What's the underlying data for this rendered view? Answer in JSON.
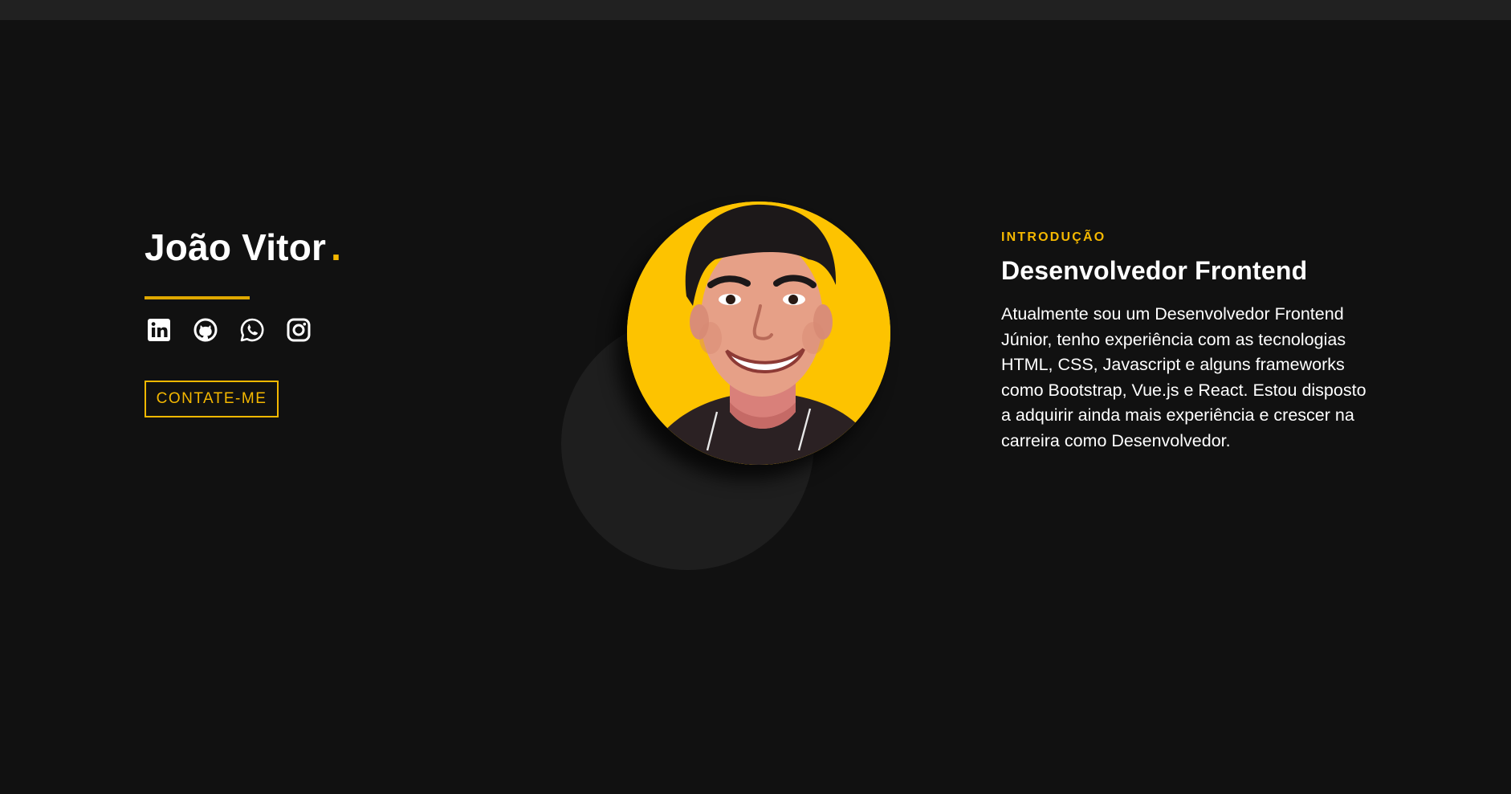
{
  "hero": {
    "name": "João Vitor",
    "name_dot": ".",
    "contact_button": "CONTATE-ME",
    "socials": [
      {
        "name": "LinkedIn",
        "icon": "linkedin-icon"
      },
      {
        "name": "GitHub",
        "icon": "github-icon"
      },
      {
        "name": "WhatsApp",
        "icon": "whatsapp-icon"
      },
      {
        "name": "Instagram",
        "icon": "instagram-icon"
      }
    ]
  },
  "intro": {
    "eyebrow": "INTRODUÇÃO",
    "title": "Desenvolvedor Frontend",
    "bio": "Atualmente sou um Desenvolvedor Frontend Júnior, tenho experiência com as tecnologias HTML, CSS, Javascript e alguns frameworks como Bootstrap, Vue.js e React. Estou disposto a adquirir ainda mais experiência e crescer na carreira como Desenvolvedor."
  },
  "colors": {
    "background": "#111111",
    "accent": "#f5b800",
    "portrait_bg": "#fdc300",
    "text": "#ffffff",
    "topbar": "#212121"
  }
}
